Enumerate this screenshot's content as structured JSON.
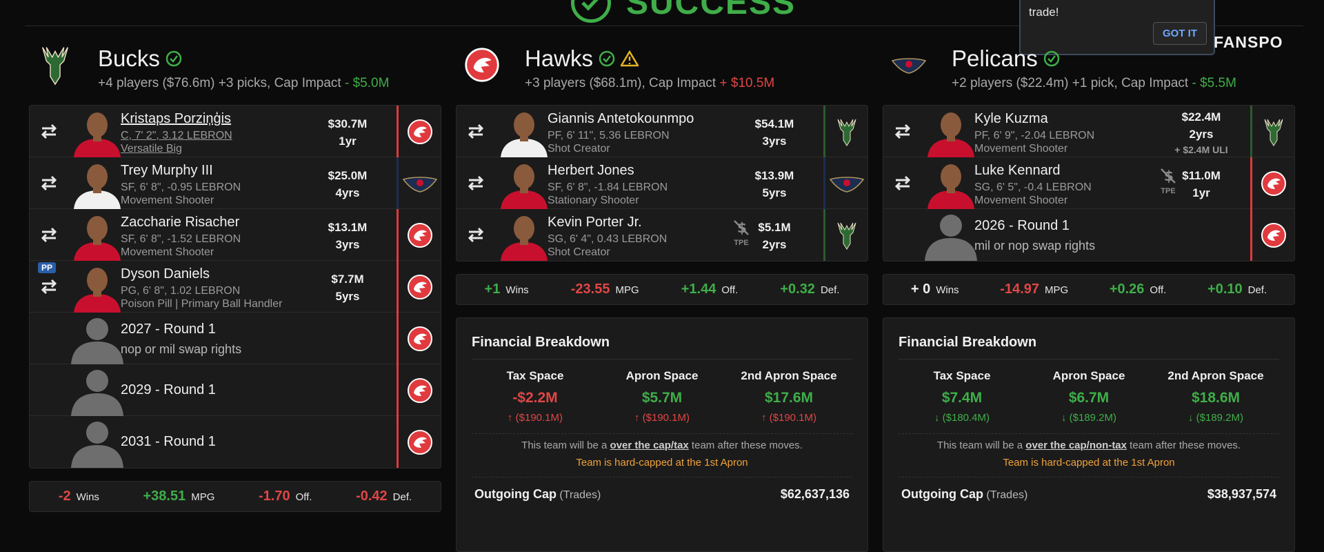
{
  "success_label": "SUCCESS",
  "brand": "FANSPO",
  "tooltip": {
    "text": "trade!",
    "button": "GOT IT"
  },
  "colors": {
    "positive": "#3fae49",
    "negative": "#e04646",
    "hawks": "#e03a3e",
    "pelicans": "#1d2d50",
    "bucks": "#2d5a2e"
  },
  "teams": [
    {
      "name": "Bucks",
      "summary": {
        "text": "+4 players ($76.6m) +3 picks, Cap Impact ",
        "impact": "- $5.0M"
      },
      "rows": [
        {
          "name": "Kristaps Porziņģis",
          "meta1": "C, 7' 2\", 3.12 LEBRON",
          "meta2": "Versatile Big",
          "salary": "$30.7M",
          "years": "1yr",
          "dest": "hawks"
        },
        {
          "name": "Trey Murphy III",
          "meta1": "SF, 6' 8\", -0.95 LEBRON",
          "meta2": "Movement Shooter",
          "salary": "$25.0M",
          "years": "4yrs",
          "dest": "pelicans"
        },
        {
          "name": "Zaccharie Risacher",
          "meta1": "SF, 6' 8\", -1.52 LEBRON",
          "meta2": "Movement Shooter",
          "salary": "$13.1M",
          "years": "3yrs",
          "dest": "hawks"
        },
        {
          "name": "Dyson Daniels",
          "badge": "PP",
          "meta1": "PG, 6' 8\", 1.02 LEBRON",
          "meta2": "Poison Pill | Primary Ball Handler",
          "salary": "$7.7M",
          "years": "5yrs",
          "dest": "hawks"
        },
        {
          "pick": "2027 - Round 1",
          "pick_sub": "nop or mil swap rights",
          "dest": "hawks"
        },
        {
          "pick": "2029 - Round 1",
          "dest": "hawks"
        },
        {
          "pick": "2031 - Round 1",
          "dest": "hawks"
        }
      ],
      "stats": [
        {
          "v": "-2",
          "l": "Wins",
          "s": "neg"
        },
        {
          "v": "+38.51",
          "l": "MPG",
          "s": "pos"
        },
        {
          "v": "-1.70",
          "l": "Off.",
          "s": "neg"
        },
        {
          "v": "-0.42",
          "l": "Def.",
          "s": "neg"
        }
      ]
    },
    {
      "name": "Hawks",
      "summary": {
        "text": "+3 players ($68.1m), Cap Impact ",
        "impact": "+ $10.5M"
      },
      "rows": [
        {
          "name": "Giannis Antetokounmpo",
          "meta1": "PF, 6' 11\", 5.36 LEBRON",
          "meta2": "Shot Creator",
          "salary": "$54.1M",
          "years": "3yrs",
          "dest": "bucks"
        },
        {
          "name": "Herbert Jones",
          "meta1": "SF, 6' 8\", -1.84 LEBRON",
          "meta2": "Stationary Shooter",
          "salary": "$13.9M",
          "years": "5yrs",
          "dest": "pelicans"
        },
        {
          "name": "Kevin Porter Jr.",
          "meta1": "SG, 6' 4\", 0.43 LEBRON",
          "meta2": "Shot Creator",
          "salary": "$5.1M",
          "years": "2yrs",
          "dest": "bucks",
          "tpe": "TPE"
        }
      ],
      "stats": [
        {
          "v": "+1",
          "l": "Wins",
          "s": "pos"
        },
        {
          "v": "-23.55",
          "l": "MPG",
          "s": "neg"
        },
        {
          "v": "+1.44",
          "l": "Off.",
          "s": "pos"
        },
        {
          "v": "+0.32",
          "l": "Def.",
          "s": "pos"
        }
      ],
      "finance": {
        "title": "Financial Breakdown",
        "cols": [
          {
            "h": "Tax Space",
            "v": "-$2.2M",
            "vs": "neg",
            "d": "($190.1M)",
            "dir": "up"
          },
          {
            "h": "Apron Space",
            "v": "$5.7M",
            "vs": "pos",
            "d": "($190.1M)",
            "dir": "up"
          },
          {
            "h": "2nd Apron Space",
            "v": "$17.6M",
            "vs": "pos",
            "d": "($190.1M)",
            "dir": "up"
          }
        ],
        "note_pre": "This team will be a ",
        "note_link": "over the cap/tax",
        "note_post": " team after these moves.",
        "hard": "Team is hard-capped at the 1st Apron",
        "out_label": "Outgoing Cap",
        "out_sub": " (Trades)",
        "out_amt": "$62,637,136"
      }
    },
    {
      "name": "Pelicans",
      "summary": {
        "text": "+2 players ($22.4m) +1 pick, Cap Impact ",
        "impact": "- $5.5M"
      },
      "rows": [
        {
          "name": "Kyle Kuzma",
          "meta1": "PF, 6' 9\", -2.04 LEBRON",
          "meta2": "Movement Shooter",
          "salary": "$22.4M",
          "years": "2yrs",
          "ext": "+ $2.4M ULI",
          "dest": "bucks"
        },
        {
          "name": "Luke Kennard",
          "meta1": "SG, 6' 5\", -0.4 LEBRON",
          "meta2": "Movement Shooter",
          "salary": "$11.0M",
          "years": "1yr",
          "dest": "hawks",
          "tpe": "TPE"
        },
        {
          "pick": "2026 - Round 1",
          "pick_sub": "mil or nop swap rights",
          "dest": "hawks"
        }
      ],
      "stats": [
        {
          "v": "+ 0",
          "l": "Wins",
          "s": "zero"
        },
        {
          "v": "-14.97",
          "l": "MPG",
          "s": "neg"
        },
        {
          "v": "+0.26",
          "l": "Off.",
          "s": "pos"
        },
        {
          "v": "+0.10",
          "l": "Def.",
          "s": "pos"
        }
      ],
      "finance": {
        "title": "Financial Breakdown",
        "cols": [
          {
            "h": "Tax Space",
            "v": "$7.4M",
            "vs": "pos",
            "d": "($180.4M)",
            "dir": "down"
          },
          {
            "h": "Apron Space",
            "v": "$6.7M",
            "vs": "pos",
            "d": "($189.2M)",
            "dir": "down"
          },
          {
            "h": "2nd Apron Space",
            "v": "$18.6M",
            "vs": "pos",
            "d": "($189.2M)",
            "dir": "down"
          }
        ],
        "note_pre": "This team will be a ",
        "note_link": "over the cap/non-tax",
        "note_post": " team after these moves.",
        "hard": "Team is hard-capped at the 1st Apron",
        "out_label": "Outgoing Cap",
        "out_sub": " (Trades)",
        "out_amt": "$38,937,574"
      }
    }
  ]
}
